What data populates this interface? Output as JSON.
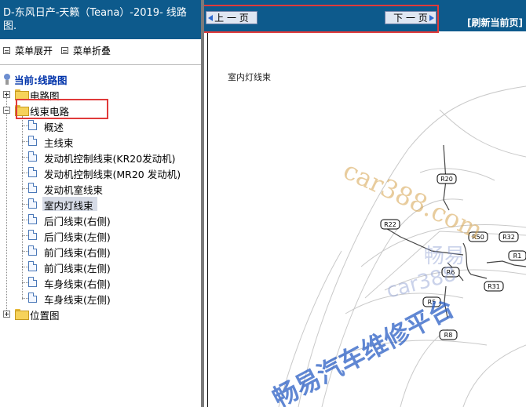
{
  "left": {
    "title": "D-东风日产-天籁（Teana）-2019- 线路图.",
    "menu_expand": "菜单展开",
    "menu_collapse": "菜单折叠",
    "current": "当前:线路图",
    "tree": {
      "circuit": "电路图",
      "harness": "线束电路",
      "harness_children": [
        "概述",
        "主线束",
        "发动机控制线束(KR20发动机)",
        "发动机控制线束(MR20 发动机)",
        "发动机室线束",
        "室内灯线束",
        "后门线束(右侧)",
        "后门线束(左侧)",
        "前门线束(右侧)",
        "前门线束(左侧)",
        "车身线束(右侧)",
        "车身线束(左侧)"
      ],
      "location": "位置图"
    }
  },
  "right": {
    "prev_label": "上 一 页",
    "next_label": "下 一 页",
    "refresh_label": "[刷新当前页]",
    "diagram_title": "室内灯线束",
    "connectors": [
      "R20",
      "R22",
      "R50",
      "R32",
      "R1",
      "R6",
      "R31",
      "R5",
      "R8"
    ],
    "watermark_site": "car388.com",
    "watermark_mid": "畅易",
    "watermark_site2": "car388",
    "watermark_platform": "畅易汽车维修平台"
  },
  "colors": {
    "header_bg": "#0d5a8c",
    "highlight_border": "#e03a3a",
    "selected_bg": "#d6dbe6"
  }
}
